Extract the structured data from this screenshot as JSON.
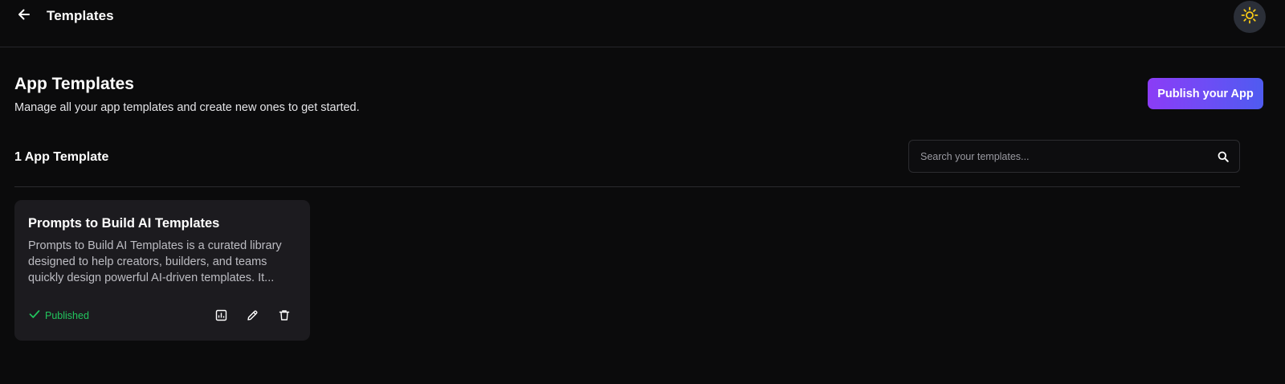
{
  "header": {
    "title": "Templates",
    "back_icon": "arrow-left-icon",
    "theme_icon": "sun-icon",
    "theme_icon_color": "#facc15"
  },
  "main": {
    "heading": "App Templates",
    "subtitle": "Manage all your app templates and create new ones to get started.",
    "publish_button": "Publish your App",
    "accent_gradient": [
      "#8b3cf6",
      "#4f5bf0"
    ],
    "template_count": "1 App Template",
    "search": {
      "placeholder": "Search your templates...",
      "value": "",
      "icon": "search-icon"
    }
  },
  "templates": [
    {
      "title": "Prompts to Build AI Templates",
      "description": "Prompts to Build AI Templates is a curated library designed to help creators, builders, and teams quickly design powerful AI-driven templates. It...",
      "status": "Published",
      "status_color": "#22c55e",
      "actions": [
        "analytics-icon",
        "edit-icon",
        "delete-icon"
      ]
    }
  ]
}
